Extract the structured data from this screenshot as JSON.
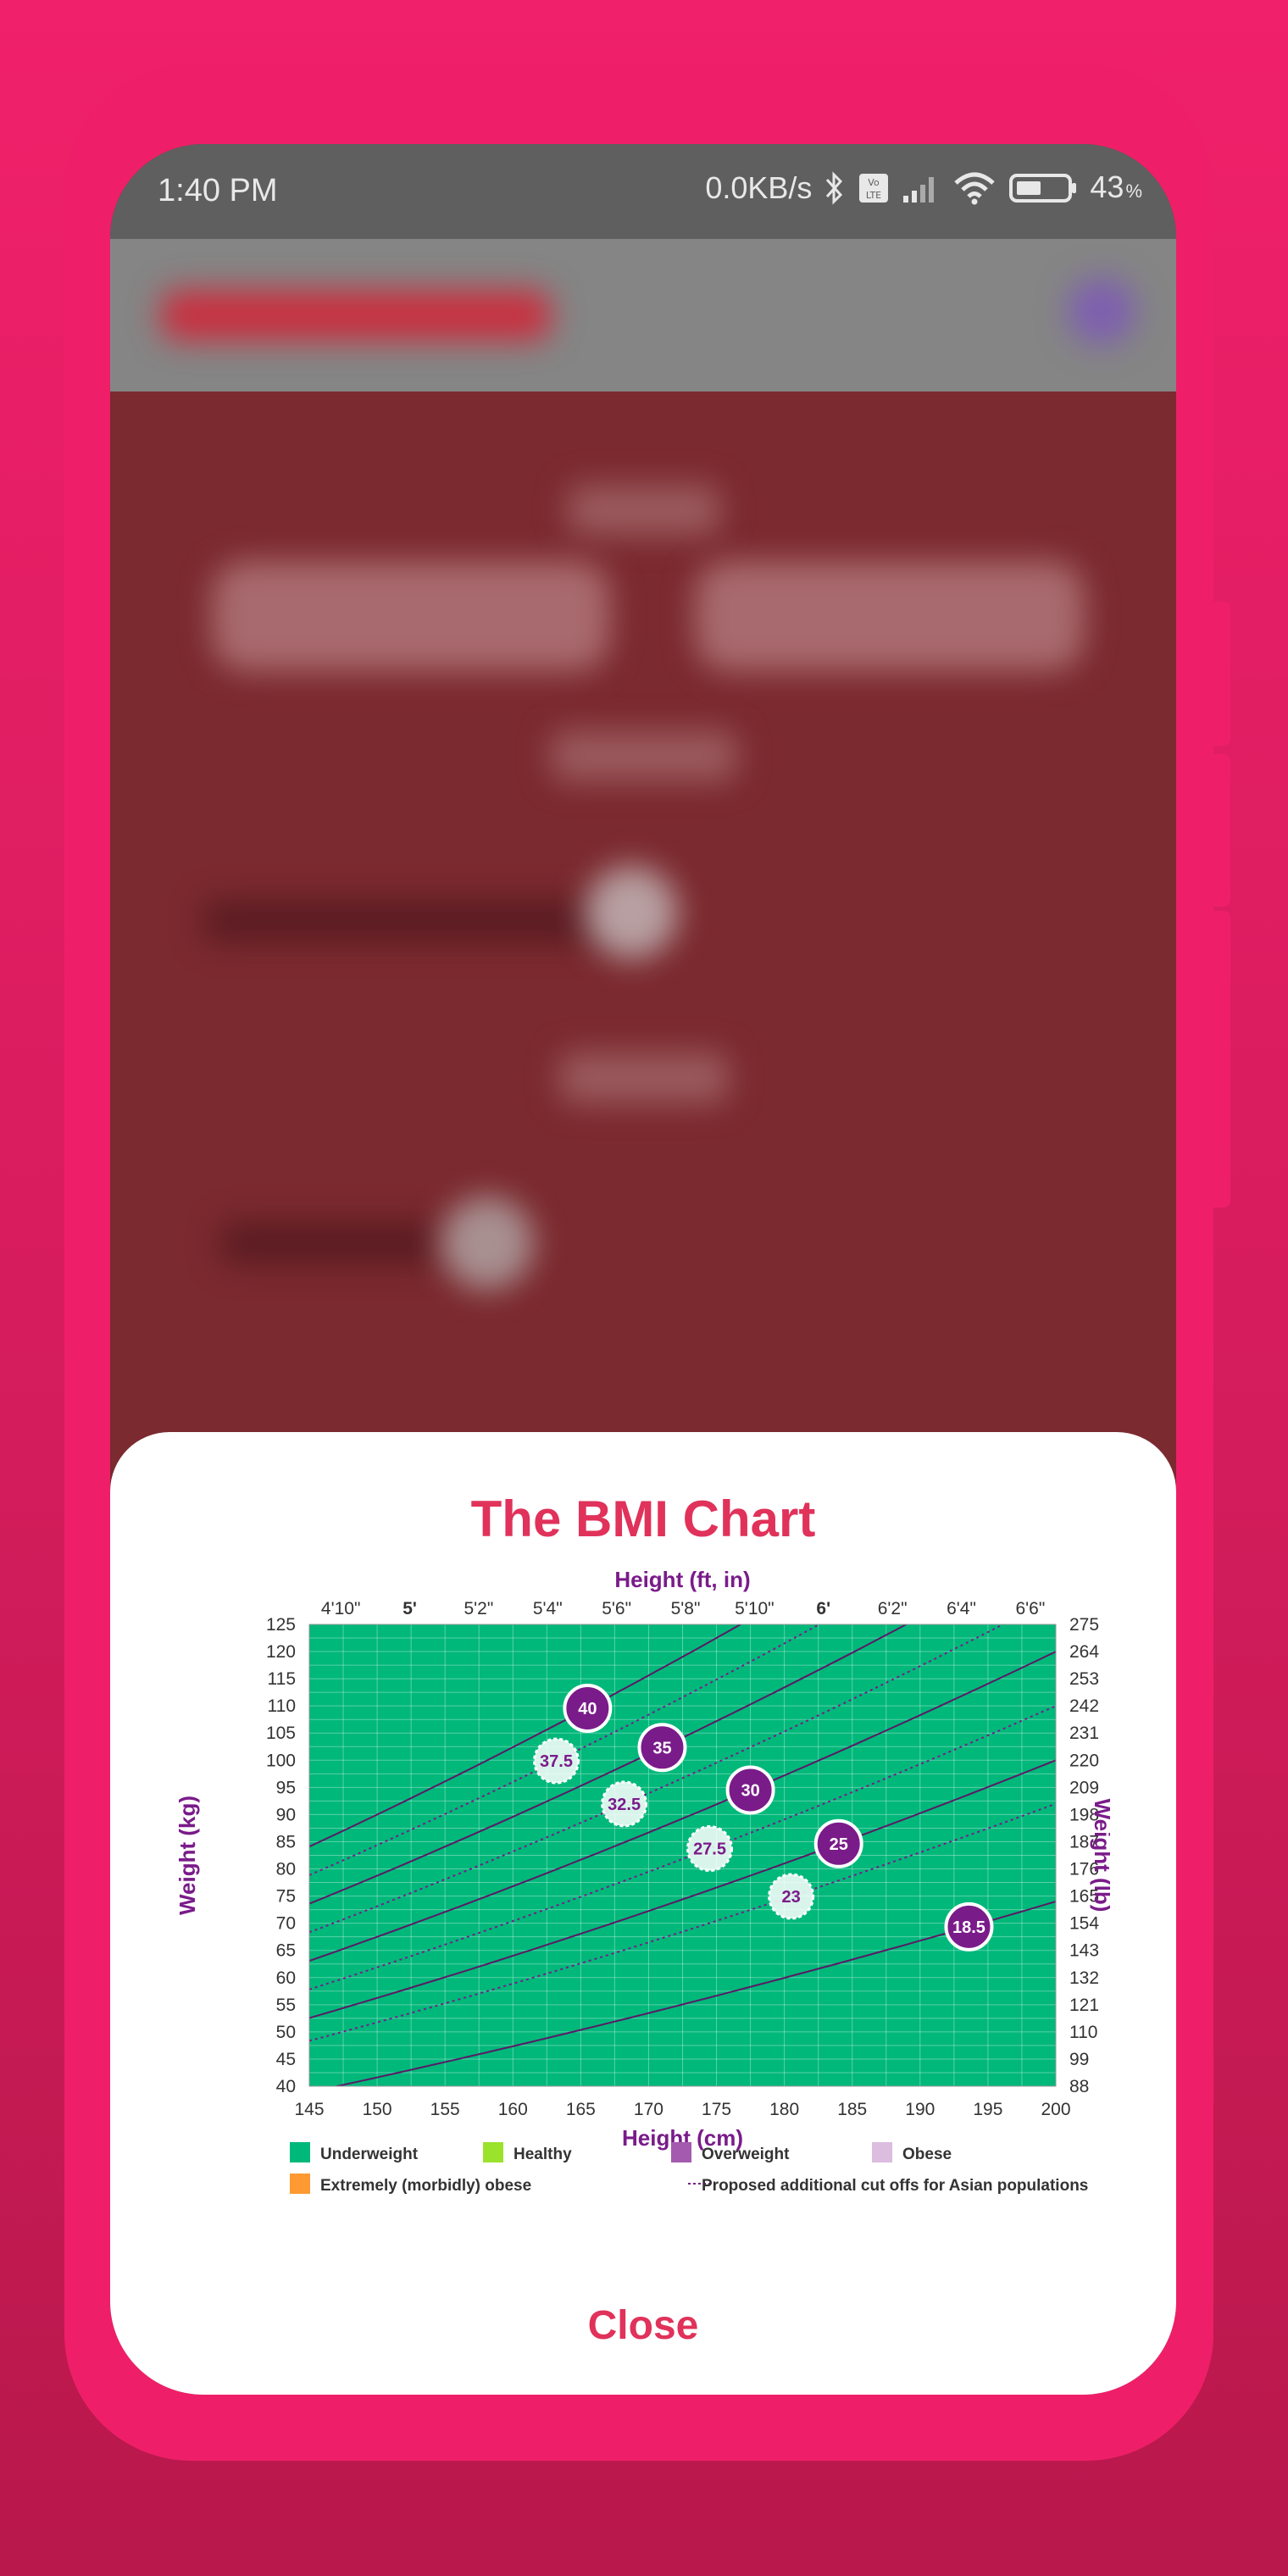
{
  "status_bar": {
    "time": "1:40 PM",
    "network_speed": "0.0KB/s",
    "battery_level": "43",
    "battery_unit": "%",
    "icons": [
      "bluetooth-icon",
      "volte-icon",
      "signal-icon",
      "wifi-icon",
      "battery-icon"
    ]
  },
  "modal": {
    "title": "The BMI Chart",
    "close_label": "Close"
  },
  "chart_data": {
    "type": "area",
    "top_axis_label": "Height (ft, in)",
    "top_ticks": [
      {
        "label": "4'10\"",
        "cm": 147.32,
        "bold": false
      },
      {
        "label": "5'",
        "cm": 152.4,
        "bold": true
      },
      {
        "label": "5'2\"",
        "cm": 157.48,
        "bold": false
      },
      {
        "label": "5'4\"",
        "cm": 162.56,
        "bold": false
      },
      {
        "label": "5'6\"",
        "cm": 167.64,
        "bold": false
      },
      {
        "label": "5'8\"",
        "cm": 172.72,
        "bold": false
      },
      {
        "label": "5'10\"",
        "cm": 177.8,
        "bold": false
      },
      {
        "label": "6'",
        "cm": 182.88,
        "bold": true
      },
      {
        "label": "6'2\"",
        "cm": 187.96,
        "bold": false
      },
      {
        "label": "6'4\"",
        "cm": 193.04,
        "bold": false
      },
      {
        "label": "6'6\"",
        "cm": 198.12,
        "bold": false
      }
    ],
    "xlabel": "Height (cm)",
    "x_ticks": [
      "145",
      "150",
      "155",
      "160",
      "165",
      "170",
      "175",
      "180",
      "185",
      "190",
      "195",
      "200"
    ],
    "xlim": [
      145,
      200
    ],
    "ylabel_left": "Weight (kg)",
    "y_ticks_left": [
      "125",
      "120",
      "115",
      "110",
      "105",
      "100",
      "95",
      "90",
      "85",
      "80",
      "75",
      "70",
      "65",
      "60",
      "55",
      "50",
      "45",
      "40"
    ],
    "ylim": [
      40,
      125
    ],
    "ylabel_right": "Weight (lb)",
    "y_ticks_right": [
      "275",
      "264",
      "253",
      "242",
      "231",
      "220",
      "209",
      "198",
      "187",
      "176",
      "165",
      "154",
      "143",
      "132",
      "121",
      "110",
      "99",
      "88"
    ],
    "grid": true,
    "bands": [
      {
        "category": "Underweight",
        "bmi_from": 0,
        "bmi_to": 18.5,
        "color": "#00b87a"
      },
      {
        "category": "Healthy",
        "bmi_from": 18.5,
        "bmi_to": 25,
        "color": "#9be22d"
      },
      {
        "category": "Overweight",
        "bmi_from": 25,
        "bmi_to": 30,
        "color": "#a45aae"
      },
      {
        "category": "Obese",
        "bmi_from": 30,
        "bmi_to": 40,
        "color": "#dcbcdf"
      },
      {
        "category": "Extremely (morbidly) obese",
        "bmi_from": 40,
        "bmi_to": 999,
        "color": "#ff9a33"
      }
    ],
    "solid_lines_bmi": [
      18.5,
      25,
      30,
      35,
      40
    ],
    "dotted_lines_bmi": [
      23,
      27.5,
      32.5,
      37.5
    ],
    "markers": [
      {
        "label": "40",
        "bmi": 40,
        "height_cm": 165.5,
        "style": "solid"
      },
      {
        "label": "37.5",
        "bmi": 37.5,
        "height_cm": 163.2,
        "style": "dashed"
      },
      {
        "label": "35",
        "bmi": 35,
        "height_cm": 171,
        "style": "solid"
      },
      {
        "label": "32.5",
        "bmi": 32.5,
        "height_cm": 168.2,
        "style": "dashed"
      },
      {
        "label": "30",
        "bmi": 30,
        "height_cm": 177.5,
        "style": "solid"
      },
      {
        "label": "27.5",
        "bmi": 27.5,
        "height_cm": 174.5,
        "style": "dashed"
      },
      {
        "label": "25",
        "bmi": 25,
        "height_cm": 184,
        "style": "solid"
      },
      {
        "label": "23",
        "bmi": 23,
        "height_cm": 180.5,
        "style": "dashed"
      },
      {
        "label": "18.5",
        "bmi": 18.5,
        "height_cm": 193.6,
        "style": "solid"
      }
    ],
    "legend": [
      {
        "label": "Underweight",
        "color": "#00b87a",
        "kind": "swatch"
      },
      {
        "label": "Healthy",
        "color": "#9be22d",
        "kind": "swatch"
      },
      {
        "label": "Overweight",
        "color": "#a45aae",
        "kind": "swatch"
      },
      {
        "label": "Obese",
        "color": "#dcbcdf",
        "kind": "swatch"
      },
      {
        "label": "Extremely (morbidly) obese",
        "color": "#ff9a33",
        "kind": "swatch"
      },
      {
        "label": "Proposed additional cut offs for Asian populations",
        "color": "#7a1b8a",
        "kind": "dotted"
      }
    ]
  },
  "colors": {
    "accent": "#e0325a",
    "axis_label": "#7a1b8a",
    "marker_solid": "#7a1b8a",
    "marker_dashed": "#ffffff"
  }
}
